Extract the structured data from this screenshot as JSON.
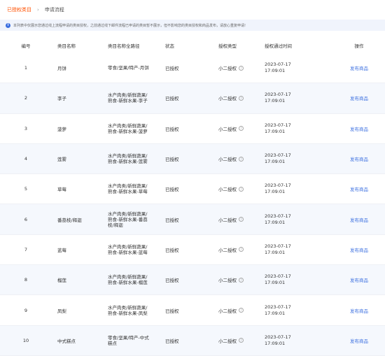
{
  "breadcrumb": {
    "authorized": "已授权类目",
    "separator": "›",
    "current": "申请流程"
  },
  "notice": {
    "icon": "info-icon",
    "text": "本列表中仅展示您通过线上流程申请的类目授权，之前通过线下邮件流程已申请的类目暂不展示，但不影响您的类目授权和商品发布，请放心重复申请!"
  },
  "columns": {
    "no": "编号",
    "name": "类目名称",
    "path": "类目名称全路径",
    "status": "状态",
    "type": "授权类型",
    "time": "授权通过时间",
    "op": "操作"
  },
  "rows": [
    {
      "no": "1",
      "name": "月饼",
      "path": "零食/坚果/特产-月饼",
      "status": "已授权",
      "type": "小二授权",
      "time": "2023-07-17 17:09:01",
      "op": "发布商品"
    },
    {
      "no": "2",
      "name": "李子",
      "path": "水产肉类/新鲜蔬果/熟食-新鲜水果-李子",
      "status": "已授权",
      "type": "小二授权",
      "time": "2023-07-17 17:09:01",
      "op": "发布商品"
    },
    {
      "no": "3",
      "name": "菠萝",
      "path": "水产肉类/新鲜蔬果/熟食-新鲜水果-菠萝",
      "status": "已授权",
      "type": "小二授权",
      "time": "2023-07-17 17:09:01",
      "op": "发布商品"
    },
    {
      "no": "4",
      "name": "莲雾",
      "path": "水产肉类/新鲜蔬果/熟食-新鲜水果-莲雾",
      "status": "已授权",
      "type": "小二授权",
      "time": "2023-07-17 17:09:01",
      "op": "发布商品"
    },
    {
      "no": "5",
      "name": "草莓",
      "path": "水产肉类/新鲜蔬果/熟食-新鲜水果-草莓",
      "status": "已授权",
      "type": "小二授权",
      "time": "2023-07-17 17:09:01",
      "op": "发布商品"
    },
    {
      "no": "6",
      "name": "番荔枝/释迦",
      "path": "水产肉类/新鲜蔬果/熟食-新鲜水果-番荔枝/释迦",
      "status": "已授权",
      "type": "小二授权",
      "time": "2023-07-17 17:09:01",
      "op": "发布商品"
    },
    {
      "no": "7",
      "name": "蓝莓",
      "path": "水产肉类/新鲜蔬果/熟食-新鲜水果-蓝莓",
      "status": "已授权",
      "type": "小二授权",
      "time": "2023-07-17 17:09:01",
      "op": "发布商品"
    },
    {
      "no": "8",
      "name": "榴莲",
      "path": "水产肉类/新鲜蔬果/熟食-新鲜水果-榴莲",
      "status": "已授权",
      "type": "小二授权",
      "time": "2023-07-17 17:09:01",
      "op": "发布商品"
    },
    {
      "no": "9",
      "name": "凤梨",
      "path": "水产肉类/新鲜蔬果/熟食-新鲜水果-凤梨",
      "status": "已授权",
      "type": "小二授权",
      "time": "2023-07-17 17:09:01",
      "op": "发布商品"
    },
    {
      "no": "10",
      "name": "中式糕点",
      "path": "零食/坚果/特产-中式糕点",
      "status": "已授权",
      "type": "小二授权",
      "time": "2023-07-17 17:09:01",
      "op": "发布商品"
    }
  ],
  "help_icon": "question-circle-icon",
  "colors": {
    "accent": "#ff5000",
    "link": "#3b6fe0",
    "notice_bg": "#f0f4fc",
    "alt_row_bg": "#f5f8fd"
  }
}
